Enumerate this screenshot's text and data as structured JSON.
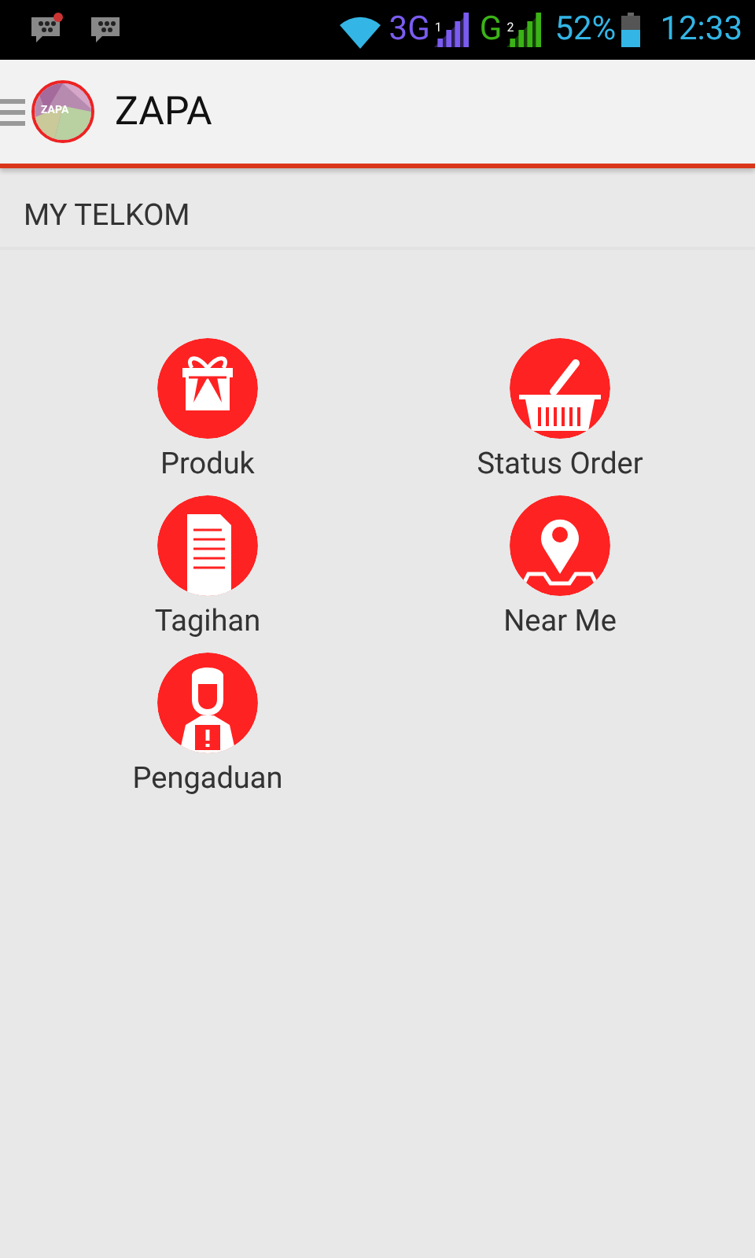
{
  "status_bar": {
    "network": "3G",
    "sim_1": "1",
    "network_2": "G",
    "sim_2": "2",
    "battery": "52%",
    "time": "12:33"
  },
  "app_bar": {
    "logo_text": "ZAPA",
    "title": "ZAPA"
  },
  "section": {
    "title": "MY TELKOM"
  },
  "menu": [
    {
      "kind": "gift",
      "label": "Produk"
    },
    {
      "kind": "basket",
      "label": "Status Order"
    },
    {
      "kind": "document",
      "label": "Tagihan"
    },
    {
      "kind": "pin",
      "label": "Near Me"
    },
    {
      "kind": "person",
      "label": "Pengaduan"
    }
  ]
}
